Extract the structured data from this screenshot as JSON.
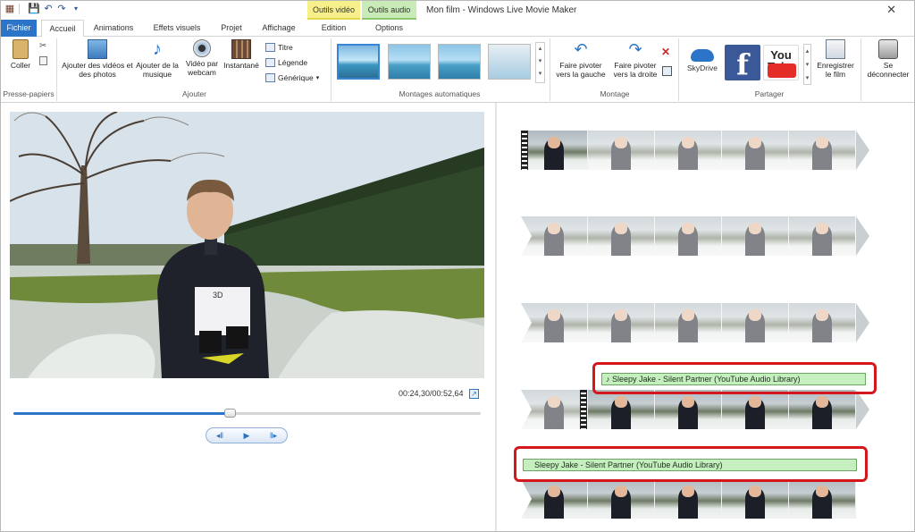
{
  "window": {
    "title": "Mon film - Windows Live Movie Maker"
  },
  "context_tabs": {
    "video_tools": "Outils vidéo",
    "audio_tools": "Outils audio"
  },
  "tabs": {
    "file": "Fichier",
    "home": "Accueil",
    "animations": "Animations",
    "visual_effects": "Effets visuels",
    "project": "Projet",
    "view": "Affichage",
    "edit": "Edition",
    "options": "Options"
  },
  "ribbon": {
    "clipboard": {
      "paste": "Coller",
      "group": "Presse-papiers"
    },
    "add": {
      "add_videos": "Ajouter des vidéos et des photos",
      "add_music": "Ajouter de la musique",
      "webcam": "Vidéo par webcam",
      "snapshot": "Instantané",
      "title": "Titre",
      "caption": "Légende",
      "credits": "Générique",
      "group": "Ajouter"
    },
    "automovie": {
      "group": "Montages automatiques"
    },
    "editing": {
      "rotate_left": "Faire pivoter vers la gauche",
      "rotate_right": "Faire pivoter vers la droite",
      "group": "Montage"
    },
    "share": {
      "skydrive": "SkyDrive",
      "youtube": "You Tube",
      "save_movie": "Enregistrer le film",
      "group": "Partager"
    },
    "signout": "Se déconnecter"
  },
  "player": {
    "time": "00:24,30/00:52,64",
    "progress": 0.462
  },
  "timeline": {
    "audio_label": "Sleepy Jake - Silent Partner (YouTube Audio Library)"
  },
  "colors": {
    "accent": "#2b74c7",
    "highlight": "#d4171d",
    "audio_bar": "#c6efc0"
  }
}
